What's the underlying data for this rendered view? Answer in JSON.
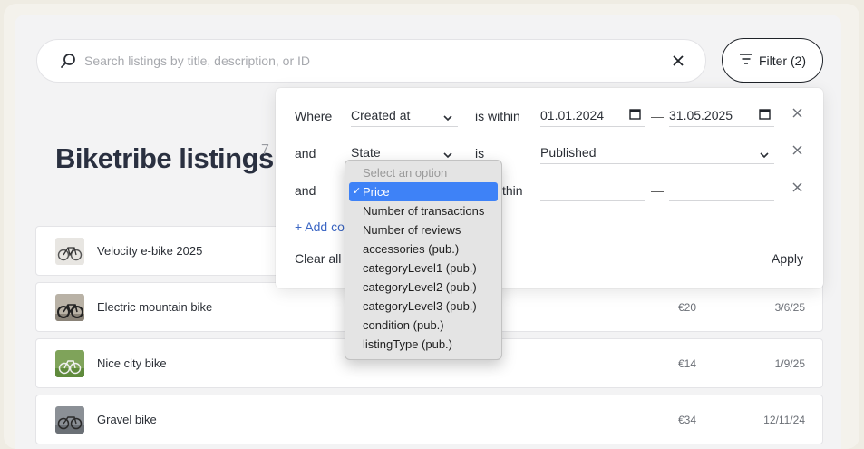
{
  "search": {
    "placeholder": "Search listings by title, description, or ID"
  },
  "filter_button": {
    "label": "Filter (2)"
  },
  "page": {
    "title": "Biketribe listings",
    "count": "7"
  },
  "listings": [
    {
      "name": "Velocity e-bike 2025",
      "price": "",
      "date": ""
    },
    {
      "name": "Electric mountain bike",
      "price": "€20",
      "date": "3/6/25"
    },
    {
      "name": "Nice city bike",
      "price": "€14",
      "date": "1/9/25"
    },
    {
      "name": "Gravel bike",
      "price": "€34",
      "date": "12/11/24"
    }
  ],
  "filters": {
    "rows": [
      {
        "connector": "Where",
        "field": "Created at",
        "operator": "is within",
        "from": "01.01.2024",
        "to": "31.05.2025"
      },
      {
        "connector": "and",
        "field": "State",
        "operator": "is",
        "value": "Published"
      },
      {
        "connector": "and",
        "field": "",
        "operator": "thin",
        "from": "",
        "to": ""
      }
    ],
    "dash": "—",
    "add_label": "+ Add co",
    "clear_label": "Clear all",
    "apply_label": "Apply"
  },
  "dropdown": {
    "placeholder": "Select an option",
    "options": [
      {
        "label": "Price",
        "selected": true
      },
      {
        "label": "Number of transactions"
      },
      {
        "label": "Number of reviews"
      },
      {
        "label": "accessories (pub.)"
      },
      {
        "label": "categoryLevel1 (pub.)"
      },
      {
        "label": "categoryLevel2 (pub.)"
      },
      {
        "label": "categoryLevel3 (pub.)"
      },
      {
        "label": "condition (pub.)"
      },
      {
        "label": "listingType (pub.)"
      }
    ],
    "check_glyph": "✓"
  },
  "colors": {
    "accent": "#3e82f7",
    "link": "#3b66c4",
    "background": "#f3f3f4"
  },
  "icons": [
    "search-icon",
    "close-icon",
    "filter-icon",
    "chevron-down-icon",
    "calendar-icon"
  ]
}
